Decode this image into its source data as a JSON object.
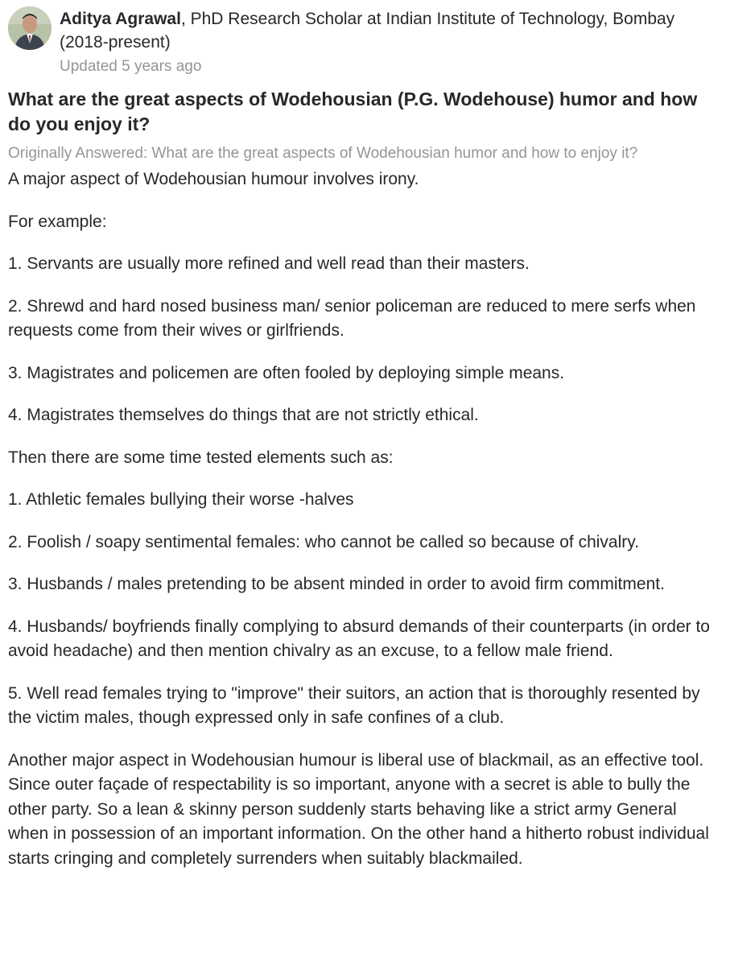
{
  "author": {
    "name": "Aditya Agrawal",
    "credential": ", PhD Research Scholar at Indian Institute of Technology, Bombay (2018-present)",
    "updated": "Updated 5 years ago"
  },
  "question": {
    "title": "What are the great aspects of Wodehousian (P.G. Wodehouse) humor and how do you enjoy it?",
    "originally_prefix": "Originally Answered: ",
    "originally_question": "What are the great aspects of Wodehousian humor and how to enjoy it?"
  },
  "answer": {
    "paragraphs": [
      "A major aspect of Wodehousian humour involves irony.",
      "For example:",
      "1. Servants are usually more refined and well read than their masters.",
      "2. Shrewd and hard nosed business man/ senior policeman are reduced to mere serfs when requests come from their wives or girlfriends.",
      "3. Magistrates and policemen are often fooled by deploying simple means.",
      "4. Magistrates themselves do things that are not strictly ethical.",
      "Then there are some time tested elements such as:",
      "1. Athletic females bullying their worse -halves",
      "2. Foolish / soapy sentimental females: who cannot be called so because of chivalry.",
      "3. Husbands / males pretending to be absent minded in order to avoid firm commitment.",
      "4. Husbands/ boyfriends finally complying to absurd demands of their counterparts (in order to avoid headache) and then mention chivalry as an excuse, to a fellow male friend.",
      "5. Well read females trying to \"improve\" their suitors, an action that is thoroughly resented by the victim males, though expressed only in safe confines of a club.",
      "Another major aspect in Wodehousian humour is liberal use of blackmail, as an effective tool. Since outer façade of respectability is so important, anyone with a secret is able to bully the other party. So a lean & skinny person suddenly starts behaving like a strict army General when in possession of an important information. On the other hand a hitherto robust individual starts cringing and completely surrenders when suitably blackmailed."
    ]
  }
}
